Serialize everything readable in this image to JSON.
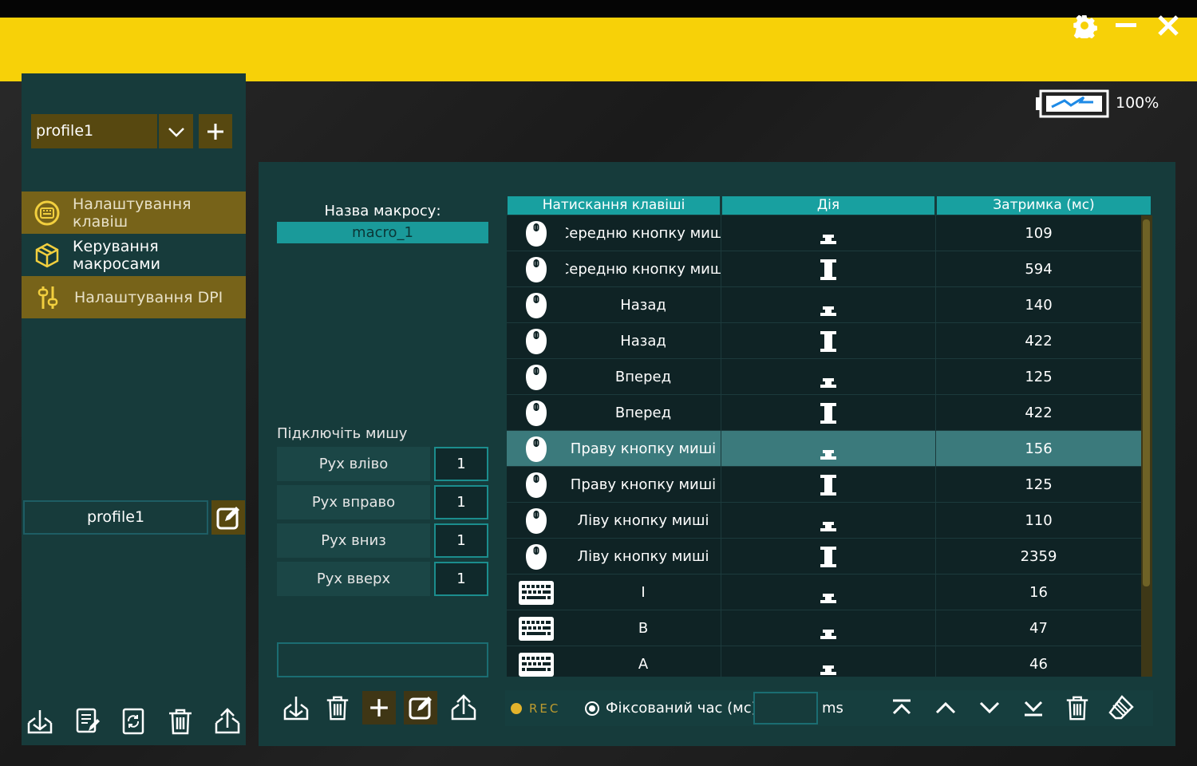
{
  "window": {
    "battery_level": "100%"
  },
  "sidebar": {
    "profile_selected": "profile1",
    "nav": [
      {
        "label": "Налаштування клавіш",
        "icon": "keyboard-icon"
      },
      {
        "label": "Керування макросами",
        "icon": "macro-cube-icon"
      },
      {
        "label": "Налаштування DPI",
        "icon": "dpi-sliders-icon"
      }
    ],
    "profile_name": "profile1"
  },
  "macro": {
    "name_label": "Назва макросу:",
    "name_value": "macro_1",
    "connect_label": "Підключіть мишу",
    "moves": [
      {
        "label": "Рух вліво",
        "value": "1"
      },
      {
        "label": "Рух вправо",
        "value": "1"
      },
      {
        "label": "Рух вниз",
        "value": "1"
      },
      {
        "label": "Рух вверх",
        "value": "1"
      }
    ]
  },
  "table": {
    "headers": [
      "Натискання клавіші",
      "Дія",
      "Затримка (мс)"
    ],
    "rows": [
      {
        "device": "mouse",
        "key": "Середню кнопку миші",
        "action": "release",
        "delay": "109"
      },
      {
        "device": "mouse",
        "key": "Середню кнопку миші",
        "action": "press",
        "delay": "594"
      },
      {
        "device": "mouse",
        "key": "Назад",
        "action": "release",
        "delay": "140"
      },
      {
        "device": "mouse",
        "key": "Назад",
        "action": "press",
        "delay": "422"
      },
      {
        "device": "mouse",
        "key": "Вперед",
        "action": "release",
        "delay": "125"
      },
      {
        "device": "mouse",
        "key": "Вперед",
        "action": "press",
        "delay": "422"
      },
      {
        "device": "mouse",
        "key": "Праву кнопку миші",
        "action": "release",
        "delay": "156",
        "selected": true
      },
      {
        "device": "mouse",
        "key": "Праву кнопку миші",
        "action": "press",
        "delay": "125"
      },
      {
        "device": "mouse",
        "key": "Ліву кнопку миші",
        "action": "release",
        "delay": "110"
      },
      {
        "device": "mouse",
        "key": "Ліву кнопку миші",
        "action": "press",
        "delay": "2359"
      },
      {
        "device": "keyboard",
        "key": "I",
        "action": "release",
        "delay": "16"
      },
      {
        "device": "keyboard",
        "key": "B",
        "action": "release",
        "delay": "47"
      },
      {
        "device": "keyboard",
        "key": "A",
        "action": "release",
        "delay": "46"
      }
    ]
  },
  "controls": {
    "rec_label": "REC",
    "fixed_time_label": "Фіксований час (мс)",
    "fixed_time_value": "",
    "ms_label": "ms"
  },
  "colors": {
    "banner": "#f7d108",
    "accent_teal": "#18a0a0",
    "accent_gold": "#776319",
    "panel": "#163b3b"
  }
}
